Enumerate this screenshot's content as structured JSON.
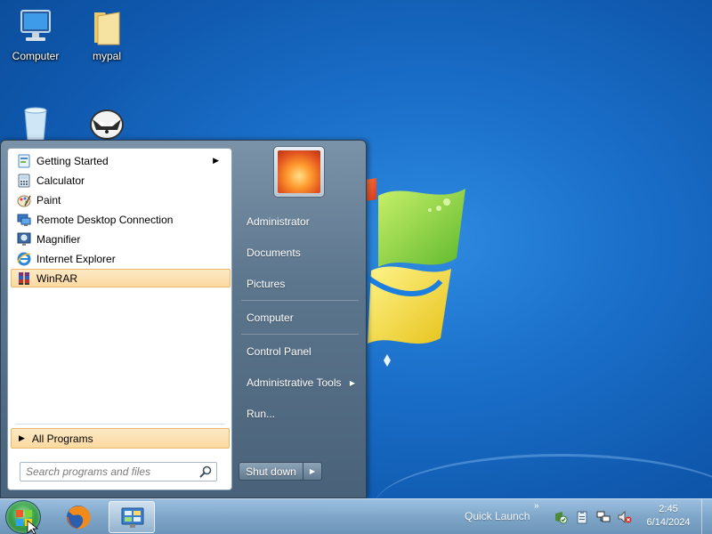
{
  "desktop": {
    "icons": [
      {
        "label": "Computer",
        "icon": "computer-icon"
      },
      {
        "label": "mypal",
        "icon": "folder-icon"
      },
      {
        "label": "",
        "icon": "recycle-bin-icon"
      },
      {
        "label": "",
        "icon": "mypal-browser-icon"
      }
    ]
  },
  "start_menu": {
    "programs": [
      {
        "label": "Getting Started",
        "icon": "getting-started-icon",
        "has_submenu": true
      },
      {
        "label": "Calculator",
        "icon": "calculator-icon"
      },
      {
        "label": "Paint",
        "icon": "paint-icon"
      },
      {
        "label": "Remote Desktop Connection",
        "icon": "remote-desktop-icon"
      },
      {
        "label": "Magnifier",
        "icon": "magnifier-icon"
      },
      {
        "label": "Internet Explorer",
        "icon": "internet-explorer-icon"
      },
      {
        "label": "WinRAR",
        "icon": "winrar-icon",
        "highlighted": true
      }
    ],
    "all_programs": "All Programs",
    "search": {
      "placeholder": "Search programs and files"
    },
    "right": [
      {
        "label": "Administrator"
      },
      {
        "label": "Documents"
      },
      {
        "label": "Pictures"
      },
      {
        "label": "Computer"
      },
      {
        "label": "Control Panel"
      },
      {
        "label": "Administrative Tools",
        "has_submenu": true
      },
      {
        "label": "Run..."
      }
    ],
    "shutdown_label": "Shut down"
  },
  "taskbar": {
    "quick_launch": "Quick Launch",
    "clock": {
      "time": "2:45",
      "date": "6/14/2024"
    },
    "pinned": [
      "start-orb",
      "firefox-icon",
      "control-panel-icon"
    ],
    "tray": [
      "action-center-icon",
      "clipboard-icon",
      "network-icon",
      "volume-muted-icon"
    ]
  },
  "colors": {
    "desktop_bg": "#1a6fc9",
    "highlight": "#fbd9a0",
    "start_menu": "#5c768e"
  }
}
